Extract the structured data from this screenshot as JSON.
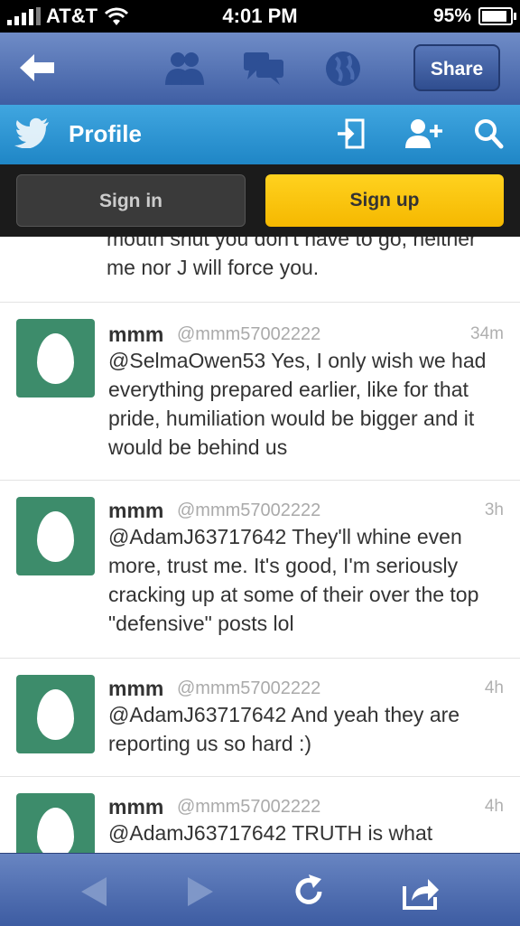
{
  "status": {
    "carrier": "AT&T",
    "time": "4:01 PM",
    "battery": "95%"
  },
  "navbar": {
    "share_label": "Share"
  },
  "header": {
    "title": "Profile"
  },
  "auth": {
    "signin_label": "Sign in",
    "signup_label": "Sign up"
  },
  "feed": {
    "partial_text": "mouth shut you don't have to go, neither me nor J will force you.",
    "tweets": [
      {
        "name": "mmm",
        "handle": "@mmm57002222",
        "time": "34m",
        "text": "@SelmaOwen53 Yes, I only wish we had everything prepared earlier, like for that pride, humiliation would be bigger and it would be behind us"
      },
      {
        "name": "mmm",
        "handle": "@mmm57002222",
        "time": "3h",
        "text": "@AdamJ63717642 They'll whine even more, trust me. It's good, I'm seriously cracking up at some of their over the top \"defensive\" posts lol"
      },
      {
        "name": "mmm",
        "handle": "@mmm57002222",
        "time": "4h",
        "text": "@AdamJ63717642 And yeah they are reporting us so hard :)"
      },
      {
        "name": "mmm",
        "handle": "@mmm57002222",
        "time": "4h",
        "text": "@AdamJ63717642 TRUTH is what"
      }
    ]
  },
  "icons": {
    "navbar": [
      "back-arrow-icon",
      "people-icon",
      "chat-bubbles-icon",
      "globe-icon"
    ],
    "header": [
      "twitter-bird-icon",
      "sign-in-icon",
      "add-user-icon",
      "search-icon"
    ],
    "toolbar": [
      "back-icon",
      "forward-icon",
      "reload-icon",
      "share-icon"
    ]
  },
  "colors": {
    "twitter_blue": "#2a94d4",
    "nav_blue": "#4a68ad",
    "signup_yellow": "#f9c400",
    "avatar_green": "#3d8c6b"
  }
}
